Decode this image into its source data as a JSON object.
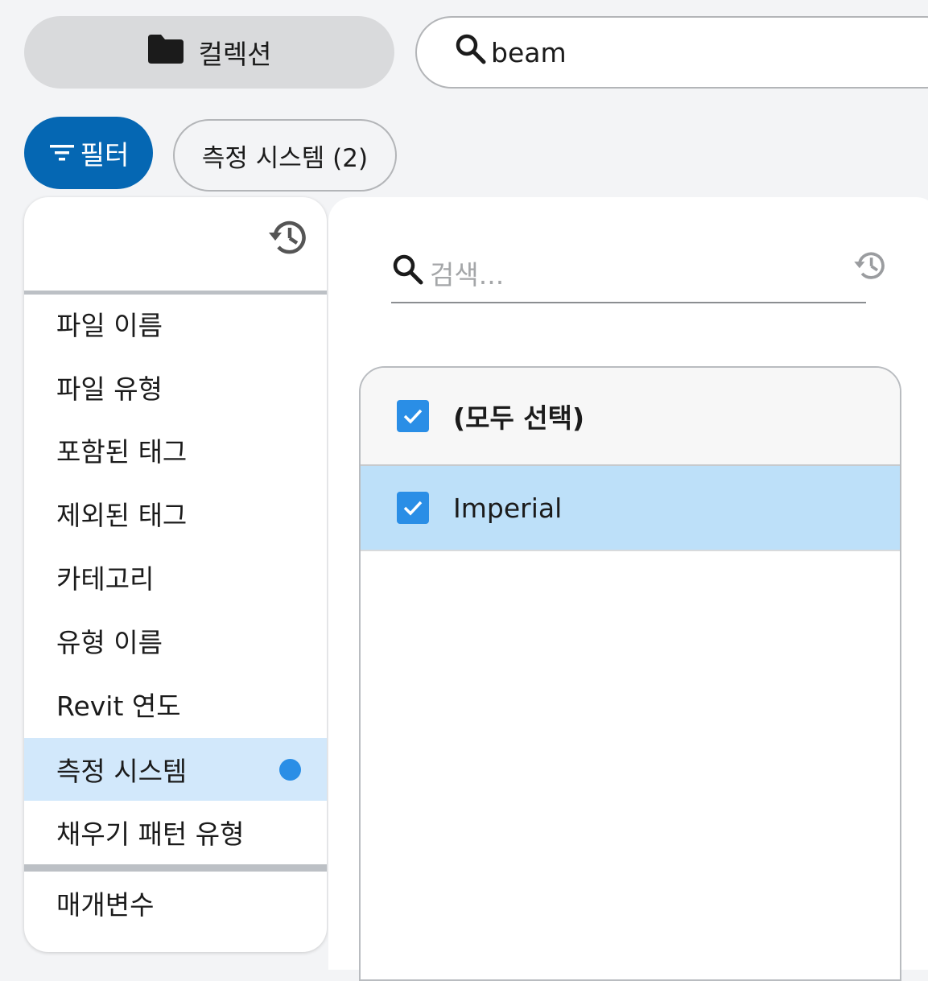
{
  "header": {
    "collection_label": "컬렉션",
    "search_value": "beam"
  },
  "filter_bar": {
    "filter_label": "필터",
    "chip_label": "측정 시스템 (2)"
  },
  "fields": {
    "items": [
      {
        "label": "파일 이름"
      },
      {
        "label": "파일 유형"
      },
      {
        "label": "포함된 태그"
      },
      {
        "label": "제외된 태그"
      },
      {
        "label": "카테고리"
      },
      {
        "label": "유형 이름"
      },
      {
        "label": "Revit 연도"
      },
      {
        "label": "측정 시스템",
        "active": true,
        "has_filter": true
      },
      {
        "label": "채우기 패턴 유형"
      }
    ],
    "parameters_label": "매개변수"
  },
  "values": {
    "search_placeholder": "검색...",
    "select_all_label": "(모두 선택)",
    "items": [
      {
        "label": "Imperial",
        "checked": true
      }
    ]
  },
  "colors": {
    "accent": "#0567b3",
    "checkbox": "#2a8ee6",
    "selected_row": "#bde0f9",
    "active_field": "#d2e8fb"
  }
}
